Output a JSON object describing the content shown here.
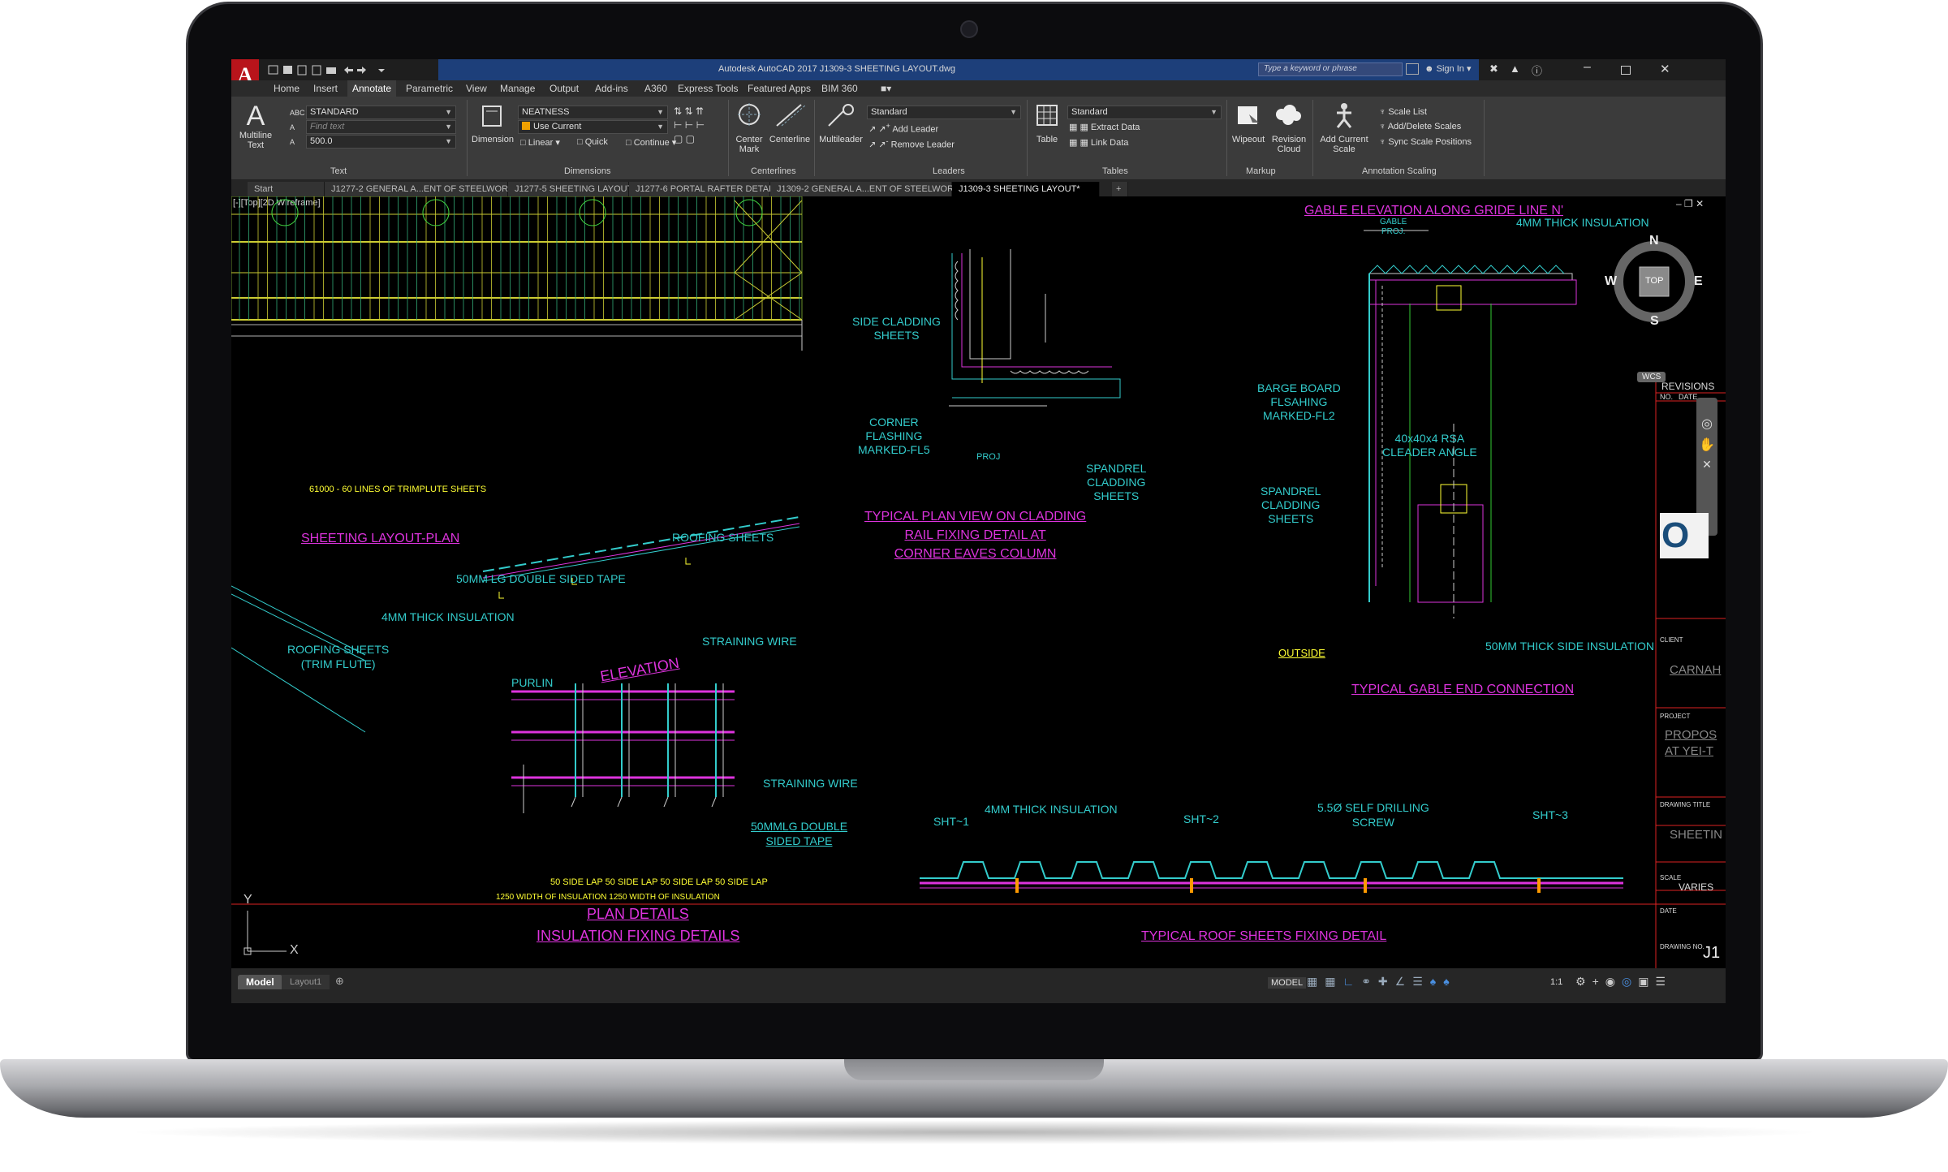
{
  "app": {
    "title": "Autodesk AutoCAD 2017   J1309-3  SHEETING LAYOUT.dwg",
    "search_placeholder": "Type a keyword or phrase",
    "sign_in": "Sign In"
  },
  "menu": [
    "Home",
    "Insert",
    "Annotate",
    "Parametric",
    "View",
    "Manage",
    "Output",
    "Add-ins",
    "A360",
    "Express Tools",
    "Featured Apps",
    "BIM 360"
  ],
  "menu_active": "Annotate",
  "ribbon": {
    "text_panel": {
      "big_button": "Multiline Text",
      "style": "STANDARD",
      "find": "Find text",
      "height": "500.0",
      "title": "Text"
    },
    "dimensions_panel": {
      "big_button": "Dimension",
      "style": "NEATNESS",
      "layer": "Use Current",
      "linear": "Linear",
      "quick": "Quick",
      "continue": "Continue",
      "title": "Dimensions"
    },
    "centerlines_panel": {
      "center_mark": "Center Mark",
      "centerline": "Centerline",
      "title": "Centerlines"
    },
    "leaders_panel": {
      "big_button": "Multileader",
      "style": "Standard",
      "add": "Add Leader",
      "remove": "Remove Leader",
      "title": "Leaders"
    },
    "tables_panel": {
      "big_button": "Table",
      "style": "Standard",
      "extract": "Extract Data",
      "link": "Link Data",
      "title": "Tables"
    },
    "markup_panel": {
      "wipeout": "Wipeout",
      "revision": "Revision Cloud",
      "title": "Markup"
    },
    "scaling_panel": {
      "add_scale": "Add Current Scale",
      "scale_list": "Scale List",
      "add_delete": "Add/Delete Scales",
      "sync": "Sync Scale Positions",
      "title": "Annotation Scaling"
    }
  },
  "doc_tabs": [
    "Start",
    "J1277-2 GENERAL A...ENT OF STEELWORK*",
    "J1277-5  SHEETING LAYOUT*",
    "J1277-6 PORTAL  RAFTER  DETAILS*",
    "J1309-2 GENERAL A...ENT OF STEELWORK*",
    "J1309-3  SHEETING LAYOUT*"
  ],
  "active_tab": "J1309-3  SHEETING LAYOUT*",
  "viewport_label": "[-][Top][2D Wireframe]",
  "drawing": {
    "sheets_dim": "61000 - 60 LINES  OF TRIMPLUTE SHEETS",
    "sheeting_plan_title": "SHEETING LAYOUT-PLAN",
    "roofing_sheets": "ROOFING SHEETS",
    "tape_50mm": "50MM LG DOUBLE SIDED TAPE",
    "insulation_4mm": "4MM THICK INSULATION",
    "straining_wire": "STRAINING WIRE",
    "purlin": "PURLIN",
    "elevation": "ELEVATION",
    "roofing_trim": [
      "ROOFING SHEETS",
      "(TRIM FLUTE)"
    ],
    "side_cladding": [
      "SIDE CLADDING",
      "SHEETS"
    ],
    "corner_flashing": [
      "CORNER",
      "FLASHING",
      "MARKED-FL5"
    ],
    "proj": "PROJ",
    "spandrel": [
      "SPANDREL",
      "CLADDING",
      "SHEETS"
    ],
    "plan_view_title": [
      "TYPICAL PLAN VIEW ON CLADDING",
      "RAIL FIXING DETAIL AT",
      "CORNER EAVES COLUMN"
    ],
    "gable_title": "GABLE  ELEVATION  ALONG  GRIDE  LINE  N'",
    "gable_proj": [
      "GABLE",
      "PROJ."
    ],
    "gable_insulation": "4MM THICK INSULATION",
    "barge_board": [
      "BARGE BOARD",
      "FLSAHING",
      "MARKED-FL2"
    ],
    "rsa": [
      "40x40x4 RSA",
      "CLEADER ANGLE"
    ],
    "gable_spandrel": [
      "SPANDREL",
      "CLADDING",
      "SHEETS"
    ],
    "outside": "OUTSIDE",
    "side_insulation": "50MM THICK  SIDE  INSULATION",
    "gable_end_title": "TYPICAL GABLE END CONNECTION",
    "straining_wire2": "STRAINING WIRE",
    "tape_50mmlg": [
      "50MMLG DOUBLE",
      "SIDED TAPE"
    ],
    "side_lap": "50 SIDE LAP 50 SIDE LAP 50 SIDE LAP 50 SIDE LAP",
    "width_insulation": "1250 WIDTH OF INSULATION     1250 WIDTH OF INSULATION",
    "plan_details": "PLAN  DETAILS",
    "insulation_fixing": "INSULATION  FIXING  DETAILS",
    "sht1": "SHT~1",
    "sht2": "SHT~2",
    "sht3": "SHT~3",
    "roof_insulation": "4MM THICK INSULATION",
    "self_drilling": [
      "5.5Ø SELF DRILLING",
      "SCREW"
    ],
    "roof_fixing_title": "TYPICAL ROOF SHEETS FIXING DETAIL"
  },
  "title_block": {
    "revisions": "REVISIONS",
    "no": "NO.",
    "date": "DATE",
    "client": "CLIENT",
    "client_name": "CARNAH",
    "project": "PROJECT",
    "project_name": [
      "PROPOS",
      "AT  YEI-T"
    ],
    "drawing_title": "DRAWING TITLE",
    "drawing_title_value": "SHEETIN",
    "scale": "SCALE",
    "scale_value": "VARIES",
    "date_label": "DATE",
    "drawing_no": "DRAWING NO.",
    "drawing_no_value": "J1"
  },
  "viewcube": {
    "n": "N",
    "s": "S",
    "e": "E",
    "w": "W",
    "top": "TOP",
    "wcs": "WCS"
  },
  "ucs": {
    "y": "Y",
    "x": "X"
  },
  "layout_tabs": [
    "Model",
    "Layout1"
  ],
  "status": {
    "model": "MODEL",
    "scale": "1:1"
  }
}
